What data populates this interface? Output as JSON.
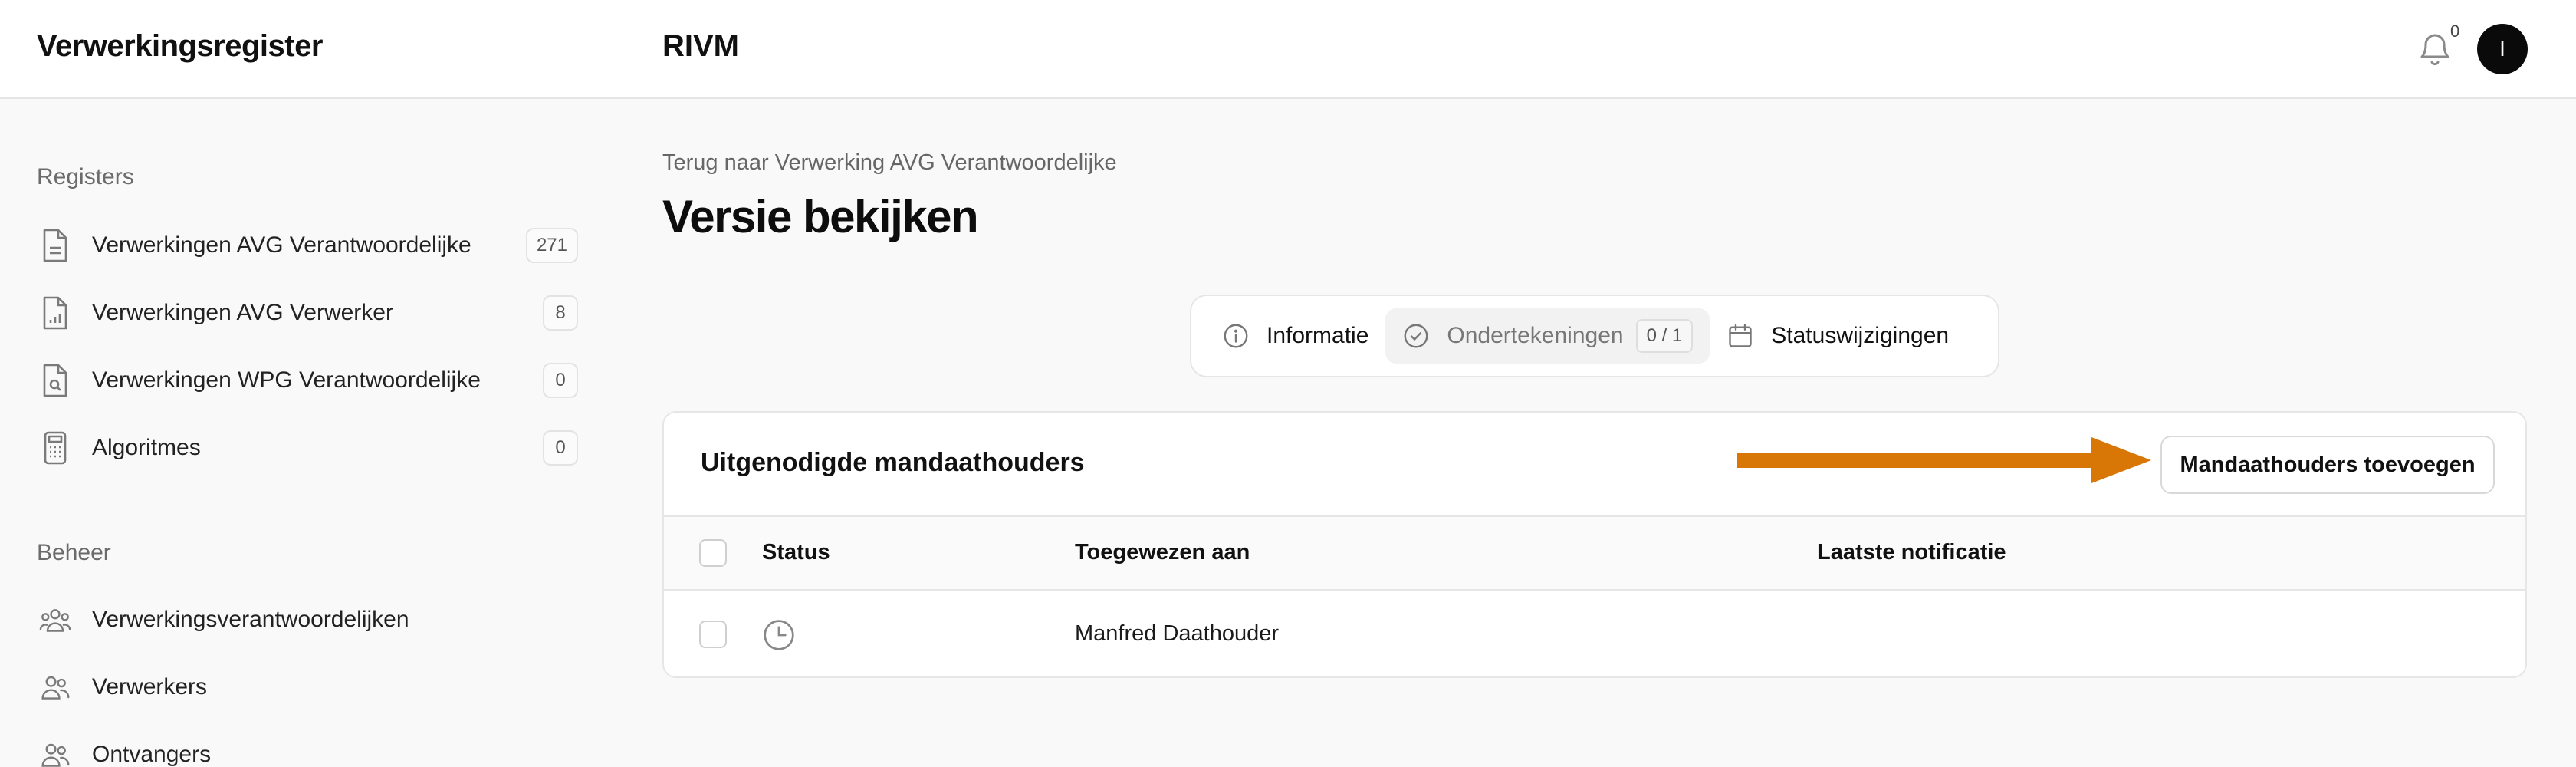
{
  "header": {
    "app_title": "Verwerkingsregister",
    "organization": "RIVM",
    "notification_count": "0",
    "avatar_initial": "I"
  },
  "sidebar": {
    "registers_label": "Registers",
    "registers": [
      {
        "label": "Verwerkingen AVG Verantwoordelijke",
        "count": "271",
        "icon": "document-icon"
      },
      {
        "label": "Verwerkingen AVG Verwerker",
        "count": "8",
        "icon": "document-chart-icon"
      },
      {
        "label": "Verwerkingen WPG Verantwoordelijke",
        "count": "0",
        "icon": "document-search-icon"
      },
      {
        "label": "Algoritmes",
        "count": "0",
        "icon": "calculator-icon"
      }
    ],
    "beheer_label": "Beheer",
    "beheer": [
      {
        "label": "Verwerkingsverantwoordelijken",
        "icon": "user-group-icon"
      },
      {
        "label": "Verwerkers",
        "icon": "users-icon"
      },
      {
        "label": "Ontvangers",
        "icon": "users-icon"
      }
    ]
  },
  "main": {
    "back_link": "Terug naar Verwerking AVG Verantwoordelijke",
    "page_title": "Versie bekijken",
    "tabs": [
      {
        "label": "Informatie",
        "icon": "info-icon"
      },
      {
        "label": "Ondertekeningen",
        "icon": "check-circle-icon",
        "count": "0 / 1",
        "active": true
      },
      {
        "label": "Statuswijzigingen",
        "icon": "calendar-icon"
      }
    ],
    "card": {
      "title": "Uitgenodigde mandaathouders",
      "add_button": "Mandaathouders toevoegen",
      "arrow_color": "#d97706",
      "columns": [
        "Status",
        "Toegewezen aan",
        "Laatste notificatie"
      ],
      "rows": [
        {
          "status_icon": "clock-icon",
          "assigned_to": "Manfred Daathouder",
          "last_notification": ""
        }
      ]
    }
  }
}
